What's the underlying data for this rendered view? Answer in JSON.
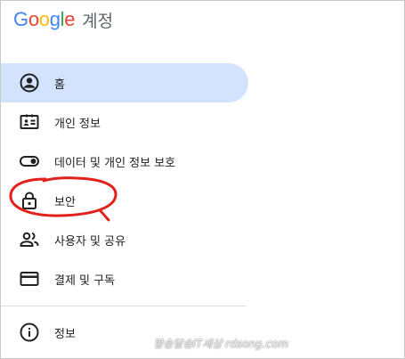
{
  "header": {
    "logo_letters": [
      "G",
      "o",
      "o",
      "g",
      "l",
      "e"
    ],
    "product_name": "계정"
  },
  "nav": {
    "items": [
      {
        "label": "홈",
        "icon": "home-person-icon",
        "active": true
      },
      {
        "label": "개인 정보",
        "icon": "id-card-icon",
        "active": false
      },
      {
        "label": "데이터 및 개인 정보 보호",
        "icon": "toggle-icon",
        "active": false
      },
      {
        "label": "보안",
        "icon": "lock-icon",
        "active": false
      },
      {
        "label": "사용자 및 공유",
        "icon": "people-icon",
        "active": false
      },
      {
        "label": "결제 및 구독",
        "icon": "credit-card-icon",
        "active": false
      },
      {
        "label": "정보",
        "icon": "info-icon",
        "active": false
      }
    ]
  },
  "watermark": "항송달송IT세상 rdsong.com",
  "colors": {
    "active_bg": "#d3e3fd",
    "annotation": "#e0211c",
    "text": "#202124"
  }
}
